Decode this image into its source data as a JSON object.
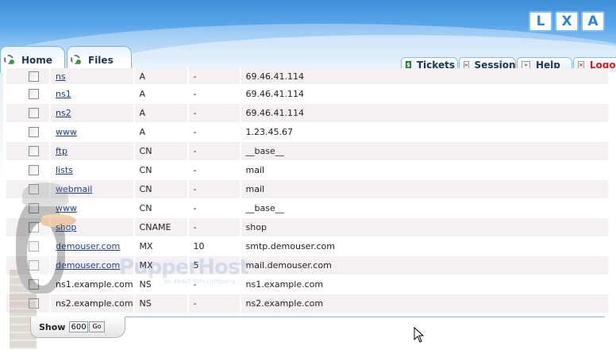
{
  "logo": {
    "letters": [
      "L",
      "X",
      "A"
    ]
  },
  "nav": {
    "tabs": [
      {
        "label": "Home",
        "icon": "gear-icon"
      },
      {
        "label": "Files",
        "icon": "gear-icon"
      }
    ],
    "right_tabs": [
      {
        "label": "Tickets",
        "icon": "ticket-icon"
      },
      {
        "label": "Session",
        "icon": "session-icon"
      },
      {
        "label": "Help",
        "icon": "help-icon"
      },
      {
        "label": "Logou",
        "icon": "logout-icon"
      }
    ]
  },
  "records": [
    {
      "name": "ns",
      "type": "A",
      "priority": "-",
      "value": "69.46.41.114",
      "linked": true
    },
    {
      "name": "ns1",
      "type": "A",
      "priority": "-",
      "value": "69.46.41.114",
      "linked": true
    },
    {
      "name": "ns2",
      "type": "A",
      "priority": "-",
      "value": "69.46.41.114",
      "linked": true
    },
    {
      "name": "www",
      "type": "A",
      "priority": "-",
      "value": "1.23.45.67",
      "linked": true
    },
    {
      "name": "ftp",
      "type": "CN",
      "priority": "-",
      "value": "__base__",
      "linked": true
    },
    {
      "name": "lists",
      "type": "CN",
      "priority": "-",
      "value": "mail",
      "linked": true
    },
    {
      "name": "webmail",
      "type": "CN",
      "priority": "-",
      "value": "mail",
      "linked": true
    },
    {
      "name": "www",
      "type": "CN",
      "priority": "-",
      "value": "__base__",
      "linked": true
    },
    {
      "name": "shop",
      "type": "CNAME",
      "priority": "-",
      "value": "shop",
      "linked": true
    },
    {
      "name": "demouser.com",
      "type": "MX",
      "priority": "10",
      "value": "smtp.demouser.com",
      "linked": true
    },
    {
      "name": "demouser.com",
      "type": "MX",
      "priority": "5",
      "value": "mail.demouser.com",
      "linked": true
    },
    {
      "name": "ns1.example.com",
      "type": "NS",
      "priority": "-",
      "value": "ns1.example.com",
      "linked": false
    },
    {
      "name": "ns2.example.com",
      "type": "NS",
      "priority": "-",
      "value": "ns2.example.com",
      "linked": false
    }
  ],
  "footer": {
    "show_label": "Show",
    "show_value": "600",
    "go_label": "Go"
  },
  "watermark": {
    "text": "PupperHost",
    "sub": "an exact lion company"
  },
  "colors": {
    "accent": "#2a86d4",
    "link": "#1b3f8a",
    "logout": "#d21f1f",
    "row_alt": "#f4f0f3"
  }
}
